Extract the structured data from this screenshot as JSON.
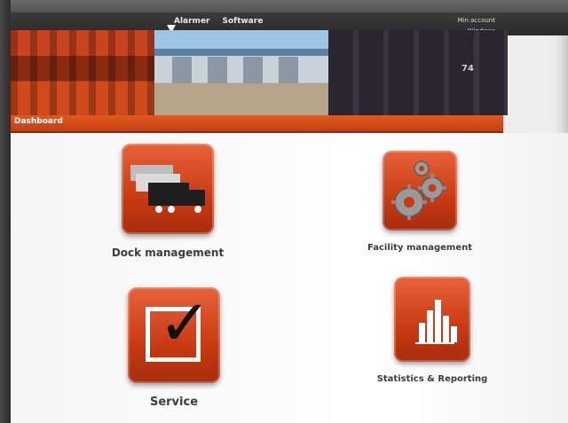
{
  "nav": {
    "links": [
      "",
      "Alarmer",
      "Software"
    ]
  },
  "user_menu": [
    "",
    "Min account",
    "Windows",
    ""
  ],
  "banner": {
    "door_number": "74"
  },
  "section": {
    "title": "Dashboard"
  },
  "tiles": [
    {
      "label": "Dock management",
      "icon": "truck-icon"
    },
    {
      "label": "Facility management",
      "icon": "gears-icon"
    },
    {
      "label": "Service",
      "icon": "checkbox-icon"
    },
    {
      "label": "Statistics & Reporting",
      "icon": "bar-chart-icon"
    }
  ],
  "colors": {
    "accent": "#d9481a",
    "dark_header": "#2e2e2e",
    "label_text": "#3c3c3c"
  }
}
